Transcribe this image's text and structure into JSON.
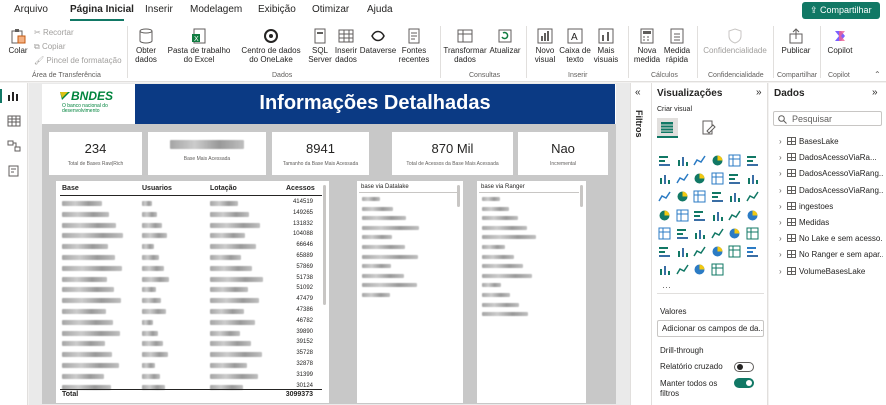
{
  "menu": {
    "tabs": [
      "Arquivo",
      "Página Inicial",
      "Inserir",
      "Modelagem",
      "Exibição",
      "Otimizar",
      "Ajuda"
    ],
    "share_label": "Compartilhar"
  },
  "ribbon": {
    "paste": "Colar",
    "cut": "Recortar",
    "copy": "Copiar",
    "format_painter": "Pincel de formatação",
    "clipboard_group": "Área de Transferência",
    "get_data": "Obter dados",
    "excel": "Pasta de trabalho do Excel",
    "onelake": "Centro de dados do OneLake",
    "sql": "SQL Server",
    "enter_data": "Inserir dados",
    "dataverse": "Dataverse",
    "recent": "Fontes recentes",
    "data_group": "Dados",
    "transform": "Transformar dados",
    "refresh": "Atualizar",
    "queries_group": "Consultas",
    "new_visual": "Novo visual",
    "textbox": "Caixa de texto",
    "more_visuals": "Mais visuais",
    "insert_group": "Inserir",
    "new_measure": "Nova medida",
    "quick_measure": "Medida rápida",
    "calcs_group": "Cálculos",
    "sensitivity": "Confidencialidade",
    "sensitivity_group": "Confidencialidade",
    "publish": "Publicar",
    "share_group": "Compartilhar",
    "copilot": "Copilot",
    "copilot_group": "Copilot"
  },
  "report": {
    "title": "Informações Detalhadas",
    "logo_text": "BNDES",
    "logo_sub": "O banco nacional do desenvolvimento",
    "cards": [
      {
        "value": "234",
        "label": "Total de Bases Raw|Rich"
      },
      {
        "value": "",
        "label": "Base Mais Acessada"
      },
      {
        "value": "8941",
        "label": "Tamanho da Base Mais Acessada"
      },
      {
        "value": "870 Mil",
        "label": "Total de Acessos da Base Mais Acessada"
      },
      {
        "value": "Nao",
        "label": "Incremental"
      }
    ],
    "main_table": {
      "headers": [
        "Base",
        "Usuarios",
        "Lotação",
        "Acessos"
      ],
      "values": [
        "414519",
        "149265",
        "131832",
        "104088",
        "66646",
        "65889",
        "57869",
        "51738",
        "51092",
        "47479",
        "47386",
        "46782",
        "39890",
        "39152",
        "35728",
        "32878",
        "31399",
        "30124"
      ],
      "total_label": "Total",
      "total_value": "3099373"
    },
    "datalake_table": {
      "header": "base via Datalake"
    },
    "ranger_table": {
      "header": "base via Ranger"
    }
  },
  "filters": {
    "label": "Filtros"
  },
  "visualizations": {
    "title": "Visualizações",
    "subtitle": "Criar visual",
    "values_label": "Valores",
    "values_placeholder": "Adicionar os campos de da...",
    "drill_label": "Drill-through",
    "cross_report": "Relatório cruzado",
    "keep_filters": "Manter todos os filtros",
    "cross_report_on": false,
    "keep_filters_on": true
  },
  "data_pane": {
    "title": "Dados",
    "search_placeholder": "Pesquisar",
    "tables": [
      "BasesLake",
      "DadosAcessoViaRa...",
      "DadosAcessoViaRang...",
      "DadosAcessoViaRang...",
      "ingestoes",
      "Medidas",
      "No Lake e sem acesso...",
      "No Ranger e sem apar...",
      "VolumeBasesLake"
    ]
  },
  "colors": {
    "accent": "#117865",
    "banner": "#0b3a84",
    "logo_green": "#00843d",
    "viz_yellow": "#f2c811"
  }
}
